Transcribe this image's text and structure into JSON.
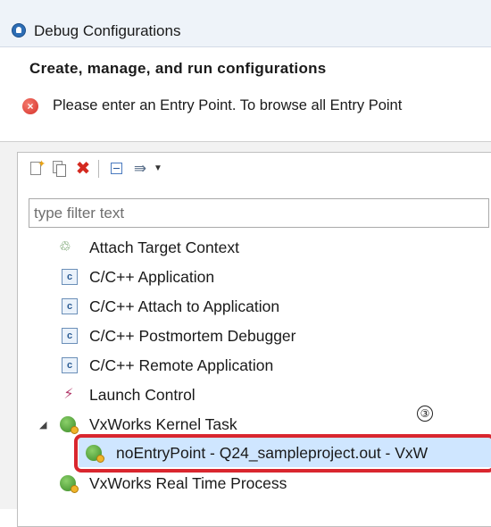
{
  "window": {
    "title": "Debug Configurations"
  },
  "banner": {
    "heading": "Create, manage, and run configurations",
    "error_message": "Please enter an Entry Point. To browse all Entry Point"
  },
  "toolbar": {
    "new_icon": "new-configuration-icon",
    "duplicate_icon": "duplicate-icon",
    "delete_icon": "delete-icon",
    "delete_glyph": "✖",
    "collapse_icon": "collapse-all-icon",
    "filter_icon": "filter-icon",
    "filter_glyph": "⇛",
    "dropdown_glyph": "▼"
  },
  "filter": {
    "placeholder": "type filter text",
    "value": ""
  },
  "tree": {
    "attach_glyph": "♲",
    "launch_glyph": "⚡",
    "c_glyph": "c",
    "collapse_glyph": "◢",
    "items": [
      {
        "label": "Attach Target Context",
        "icon": "attach-target-icon"
      },
      {
        "label": "C/C++ Application",
        "icon": "c-app-icon"
      },
      {
        "label": "C/C++ Attach to Application",
        "icon": "c-app-icon"
      },
      {
        "label": "C/C++ Postmortem Debugger",
        "icon": "c-app-icon"
      },
      {
        "label": "C/C++ Remote Application",
        "icon": "c-app-icon"
      },
      {
        "label": "Launch Control",
        "icon": "launch-control-icon"
      },
      {
        "label": "VxWorks Kernel Task",
        "icon": "vxworks-icon",
        "expanded": true
      },
      {
        "label": "noEntryPoint - Q24_sampleproject.out - VxW",
        "icon": "vxworks-config-icon",
        "selected": true
      },
      {
        "label": "VxWorks Real Time Process",
        "icon": "vxworks-icon"
      }
    ]
  },
  "annotation": {
    "marker": "③",
    "highlight_color": "#d9262e"
  },
  "colors": {
    "error": "#d6312a",
    "selection": "#cfe6ff",
    "accent": "#2d6db5"
  }
}
